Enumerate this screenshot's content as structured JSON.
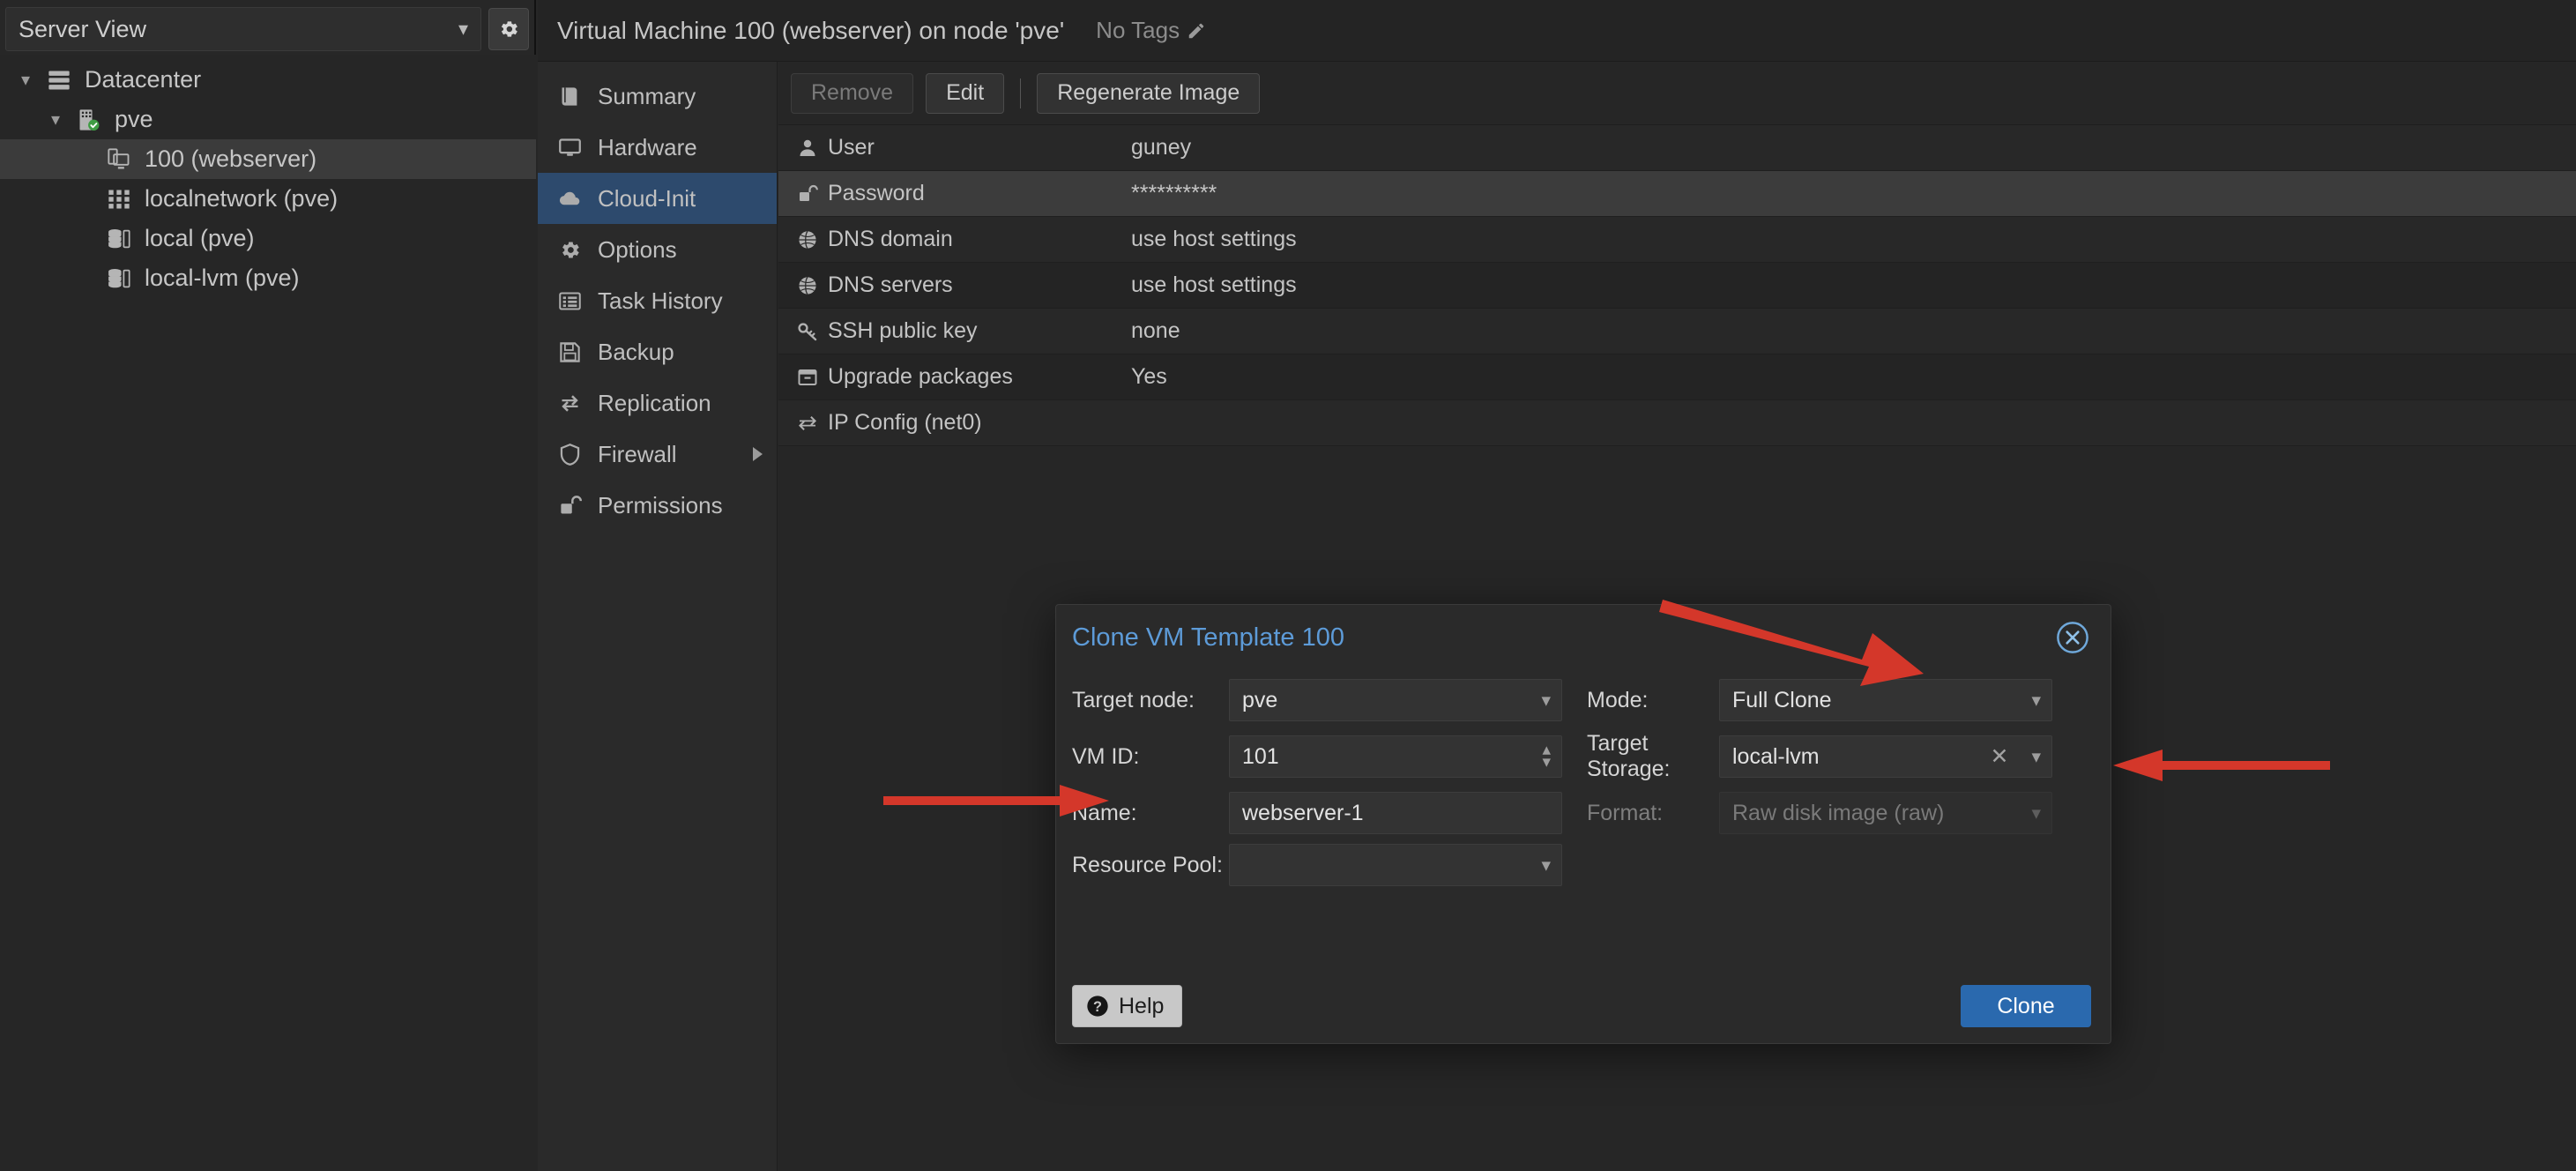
{
  "colors": {
    "accent_blue": "#2a69ae",
    "title_blue": "#5d9bd8",
    "nav_active": "#2d4a6d",
    "annotation_red": "#d4372a",
    "bg": "#262626"
  },
  "sidebar": {
    "view_selector": {
      "label": "Server View",
      "chevron": "chevron-down-icon"
    },
    "settings_icon": "gear-icon",
    "tree": [
      {
        "label": "Datacenter",
        "icon": "datacenter-icon",
        "indent": 0,
        "caret": "chevron-down-icon",
        "selected": false
      },
      {
        "label": "pve",
        "icon": "node-icon",
        "indent": 1,
        "caret": "chevron-down-icon",
        "selected": false
      },
      {
        "label": "100 (webserver)",
        "icon": "template-icon",
        "indent": 2,
        "caret": "",
        "selected": true
      },
      {
        "label": "localnetwork (pve)",
        "icon": "network-icon",
        "indent": 2,
        "caret": "",
        "selected": false
      },
      {
        "label": "local (pve)",
        "icon": "storage-icon",
        "indent": 2,
        "caret": "",
        "selected": false
      },
      {
        "label": "local-lvm (pve)",
        "icon": "storage-icon",
        "indent": 2,
        "caret": "",
        "selected": false
      }
    ]
  },
  "topbar": {
    "title": "Virtual Machine 100 (webserver) on node 'pve'",
    "tags_label": "No Tags",
    "tags_edit_icon": "pencil-icon"
  },
  "nav": {
    "items": [
      {
        "label": "Summary",
        "icon": "book-icon",
        "active": false,
        "submenu": false
      },
      {
        "label": "Hardware",
        "icon": "monitor-icon",
        "active": false,
        "submenu": false
      },
      {
        "label": "Cloud-Init",
        "icon": "cloud-icon",
        "active": true,
        "submenu": false
      },
      {
        "label": "Options",
        "icon": "gear-icon",
        "active": false,
        "submenu": false
      },
      {
        "label": "Task History",
        "icon": "list-icon",
        "active": false,
        "submenu": false
      },
      {
        "label": "Backup",
        "icon": "floppy-icon",
        "active": false,
        "submenu": false
      },
      {
        "label": "Replication",
        "icon": "replication-icon",
        "active": false,
        "submenu": false
      },
      {
        "label": "Firewall",
        "icon": "shield-icon",
        "active": false,
        "submenu": true
      },
      {
        "label": "Permissions",
        "icon": "unlock-icon",
        "active": false,
        "submenu": false
      }
    ]
  },
  "toolbar": {
    "remove_label": "Remove",
    "edit_label": "Edit",
    "regenerate_label": "Regenerate Image"
  },
  "cloudinit": {
    "rows": [
      {
        "key": "User",
        "value": "guney",
        "icon": "user-icon",
        "selected": false
      },
      {
        "key": "Password",
        "value": "**********",
        "icon": "unlock-icon",
        "selected": true
      },
      {
        "key": "DNS domain",
        "value": "use host settings",
        "icon": "globe-icon",
        "selected": false
      },
      {
        "key": "DNS servers",
        "value": "use host settings",
        "icon": "globe-icon",
        "selected": false
      },
      {
        "key": "SSH public key",
        "value": "none",
        "icon": "key-icon",
        "selected": false
      },
      {
        "key": "Upgrade packages",
        "value": "Yes",
        "icon": "package-icon",
        "selected": false
      },
      {
        "key": "IP Config (net0)",
        "value": "",
        "icon": "exchange-icon",
        "selected": false
      }
    ]
  },
  "clone_dialog": {
    "title": "Clone VM Template 100",
    "close_icon": "close-circle-icon",
    "fields": {
      "target_node": {
        "label": "Target node:",
        "value": "pve",
        "type": "select",
        "disabled": false
      },
      "vm_id": {
        "label": "VM ID:",
        "value": "101",
        "type": "spinner",
        "disabled": false
      },
      "name": {
        "label": "Name:",
        "value": "webserver-1",
        "type": "text",
        "disabled": false
      },
      "resource_pool": {
        "label": "Resource Pool:",
        "value": "",
        "type": "select",
        "disabled": false
      },
      "mode": {
        "label": "Mode:",
        "value": "Full Clone",
        "type": "select",
        "disabled": false
      },
      "target_storage": {
        "label": "Target Storage:",
        "value": "local-lvm",
        "type": "select-clear",
        "disabled": false
      },
      "format": {
        "label": "Format:",
        "value": "Raw disk image (raw)",
        "type": "select",
        "disabled": true
      }
    },
    "help_label": "Help",
    "help_icon": "question-icon",
    "clone_label": "Clone"
  },
  "annotations": [
    {
      "name": "arrow-to-name-field",
      "direction": "right",
      "color": "#d4372a"
    },
    {
      "name": "arrow-to-mode-field",
      "direction": "down-right",
      "color": "#d4372a"
    },
    {
      "name": "arrow-to-target-storage-field",
      "direction": "left",
      "color": "#d4372a"
    }
  ]
}
